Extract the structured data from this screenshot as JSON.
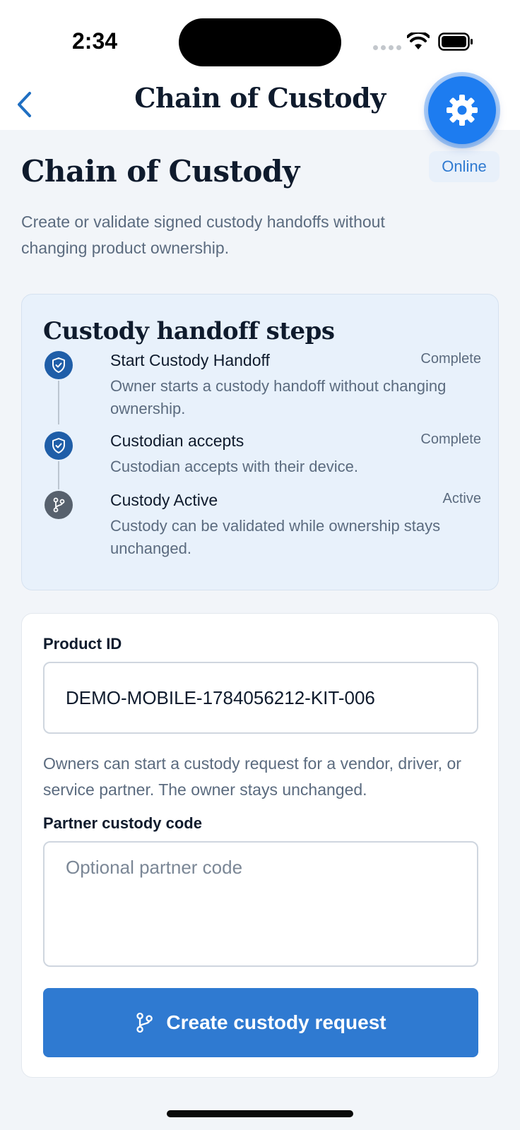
{
  "status_bar": {
    "time": "2:34"
  },
  "nav": {
    "title": "Chain of Custody"
  },
  "connection": {
    "status": "Online"
  },
  "header": {
    "title": "Chain of Custody",
    "subtitle": "Create or validate signed custody handoffs without changing product ownership."
  },
  "steps_card": {
    "title": "Custody handoff steps",
    "steps": [
      {
        "label": "Start Custody Handoff",
        "status": "Complete",
        "description": "Owner starts a custody handoff without changing ownership.",
        "icon": "shield-check-icon"
      },
      {
        "label": "Custodian accepts",
        "status": "Complete",
        "description": "Custodian accepts with their device.",
        "icon": "shield-check-icon"
      },
      {
        "label": "Custody Active",
        "status": "Active",
        "description": "Custody can be validated while ownership stays unchanged.",
        "icon": "git-branch-icon"
      }
    ]
  },
  "form": {
    "product_id_label": "Product ID",
    "product_id_value": "DEMO-MOBILE-1784056212-KIT-006",
    "help_text": "Owners can start a custody request for a vendor, driver, or service partner. The owner stays unchanged.",
    "partner_code_label": "Partner custody code",
    "partner_code_placeholder": "Optional partner code",
    "partner_code_value": "",
    "submit_label": "Create custody request"
  },
  "colors": {
    "accent": "#2f7ad1",
    "fab": "#1d7cf0",
    "step_done": "#1f5ea8",
    "step_active": "#57616d",
    "card_bg": "#e8f1fb"
  }
}
